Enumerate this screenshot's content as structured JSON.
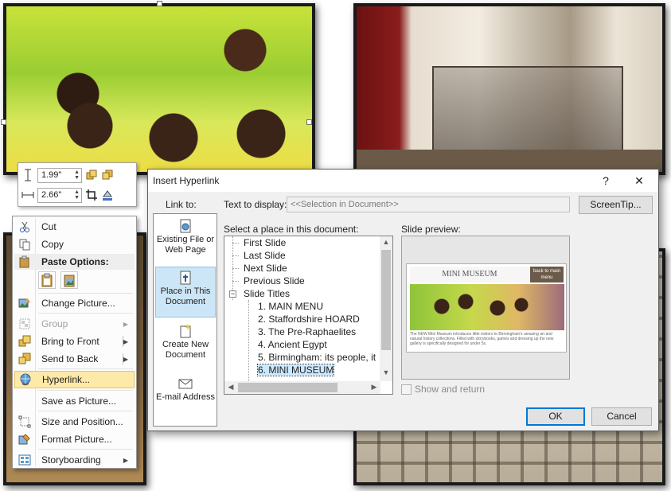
{
  "mini_toolbar": {
    "height_value": "1.99\"",
    "width_value": "2.66\""
  },
  "context_menu": {
    "items": [
      {
        "label": "Cut",
        "icon": "scissors-icon"
      },
      {
        "label": "Copy",
        "icon": "copy-icon"
      },
      {
        "label": "Paste Options:",
        "icon": "paste-icon"
      },
      {
        "label": "Change Picture...",
        "icon": "change-picture-icon"
      },
      {
        "label": "Group",
        "icon": "group-icon",
        "disabled": true
      },
      {
        "label": "Bring to Front",
        "icon": "bring-to-front-icon"
      },
      {
        "label": "Send to Back",
        "icon": "send-to-back-icon"
      },
      {
        "label": "Hyperlink...",
        "icon": "hyperlink-icon"
      },
      {
        "label": "Save as Picture...",
        "icon": ""
      },
      {
        "label": "Size and Position...",
        "icon": "size-position-icon"
      },
      {
        "label": "Format Picture...",
        "icon": "format-picture-icon"
      },
      {
        "label": "Storyboarding",
        "icon": "storyboarding-icon"
      }
    ]
  },
  "dialog": {
    "title": "Insert Hyperlink",
    "help": "?",
    "close": "✕",
    "link_to_label": "Link to:",
    "text_to_display_label": "Text to display:",
    "text_to_display_value": "<<Selection in Document>>",
    "screentip_label": "ScreenTip...",
    "select_place_label": "Select a place in this document:",
    "slide_preview_label": "Slide preview:",
    "link_to": [
      {
        "label": "Existing File or Web Page"
      },
      {
        "label": "Place in This Document",
        "selected": true
      },
      {
        "label": "Create New Document"
      },
      {
        "label": "E-mail Address"
      }
    ],
    "tree": {
      "top_items": [
        "First Slide",
        "Last Slide",
        "Next Slide",
        "Previous Slide"
      ],
      "group": "Slide Titles",
      "group_toggle": "−",
      "slides": [
        "1. MAIN MENU",
        "2. Staffordshire HOARD",
        "3. The Pre-Raphaelites",
        "4. Ancient Egypt",
        "5. Birmingham: its people, it",
        "6. MINI MUSEUM"
      ],
      "selected_index": 5
    },
    "preview": {
      "slide_title": "MINI MUSEUM",
      "back_button": "back to main menu",
      "body_text": "The NEW Mini Museum introduces little visitors to Birmingham's amazing art and natural history collections. Filled with storybooks, games and dressing up the new gallery is specifically designed for under 5s."
    },
    "show_and_return": "Show and return",
    "ok": "OK",
    "cancel": "Cancel"
  },
  "colors": {
    "selection": "#cde6f7",
    "highlight": "#fde9a8",
    "primary_border": "#0078d7"
  }
}
